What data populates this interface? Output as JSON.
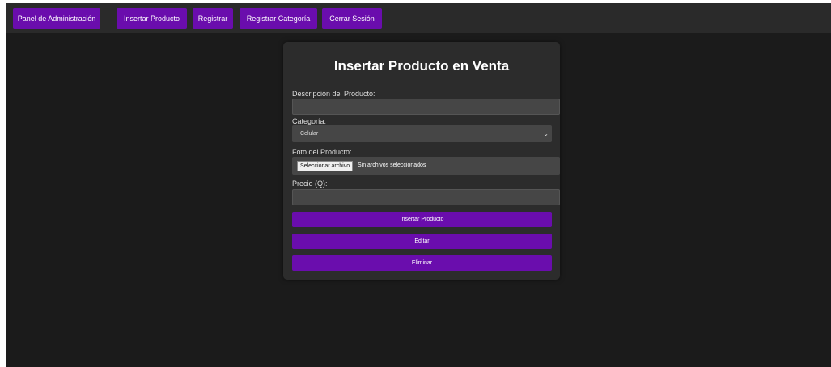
{
  "navbar": {
    "items": [
      {
        "label": "Panel de Administración"
      },
      {
        "label": "Insertar Producto"
      },
      {
        "label": "Registrar"
      },
      {
        "label": "Registrar Categoría"
      },
      {
        "label": "Cerrar Sesión"
      }
    ]
  },
  "form": {
    "title": "Insertar Producto en Venta",
    "description_label": "Descripción del Producto:",
    "description_value": "",
    "category_label": "Categoría:",
    "category_selected": "Celular",
    "photo_label": "Foto del Producto:",
    "file_button": "Seleccionar archivo",
    "file_status": "Sin archivos seleccionados",
    "price_label": "Precio (Q):",
    "price_value": "",
    "insert_button": "Insertar Producto",
    "edit_button": "Editar",
    "delete_button": "Eliminar"
  },
  "colors": {
    "accent": "#6a0dad",
    "background": "#1b1b1b",
    "card": "#2c2c2c"
  }
}
